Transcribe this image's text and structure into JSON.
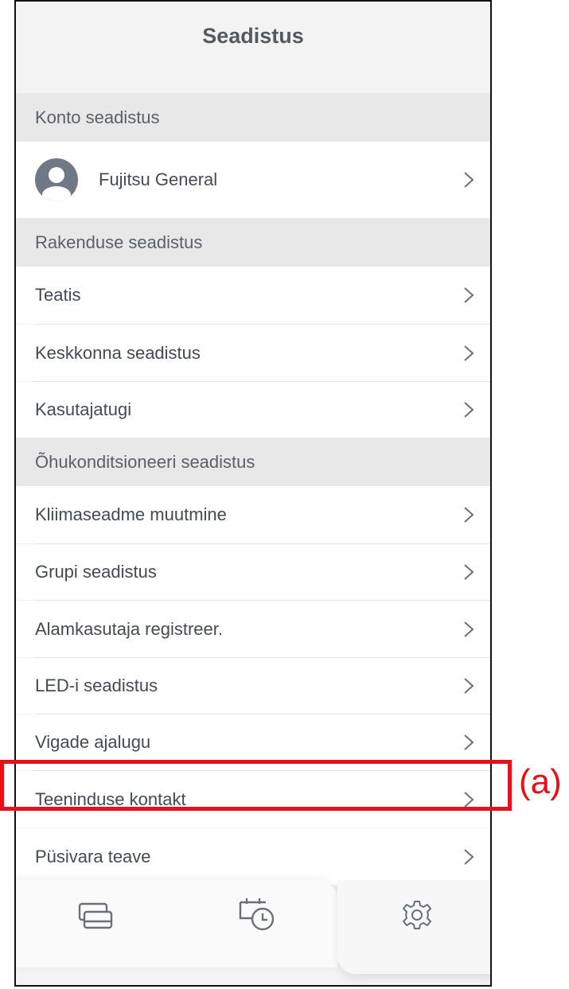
{
  "header": {
    "title": "Seadistus"
  },
  "sections": [
    {
      "title": "Konto seadistus"
    },
    {
      "title": "Rakenduse seadistus"
    },
    {
      "title": "Õhukonditsioneeri seadistus"
    }
  ],
  "account": {
    "name": "Fujitsu General"
  },
  "app_settings": [
    {
      "label": "Teatis"
    },
    {
      "label": "Keskkonna seadistus"
    },
    {
      "label": "Kasutajatugi"
    }
  ],
  "ac_settings": [
    {
      "label": "Kliimaseadme muutmine"
    },
    {
      "label": "Grupi seadistus"
    },
    {
      "label": "Alamkasutaja registreer."
    },
    {
      "label": "LED-i seadistus"
    },
    {
      "label": "Vigade ajalugu"
    },
    {
      "label": "Teeninduse kontakt"
    },
    {
      "label": "Püsivara teave"
    }
  ],
  "bottom_nav": [
    {
      "icon": "devices-icon"
    },
    {
      "icon": "timer-schedule-icon"
    },
    {
      "icon": "settings-gear-icon"
    }
  ],
  "annotation": {
    "label": "(a)",
    "color": "#e8101b"
  }
}
